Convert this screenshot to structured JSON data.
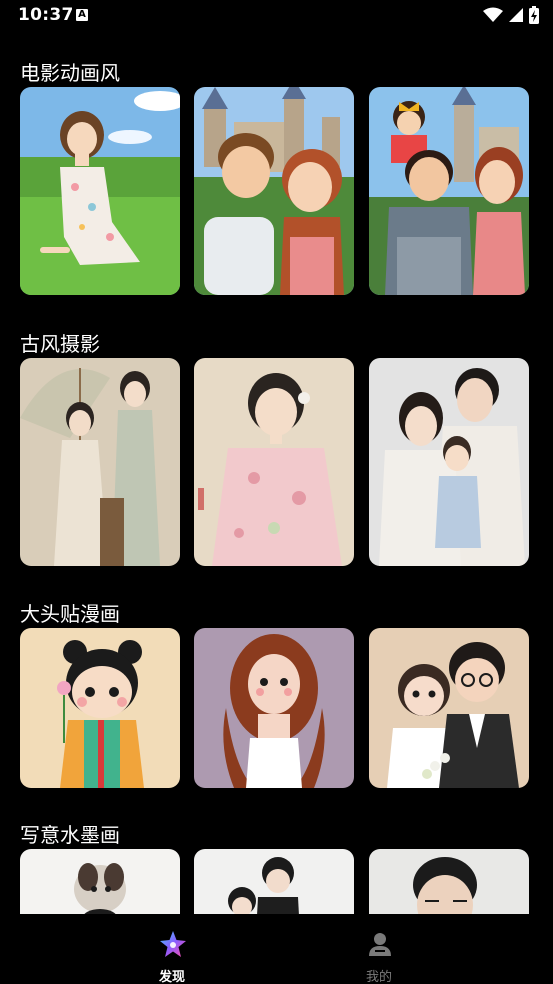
{
  "status_bar": {
    "time": "10:37",
    "notification": "A"
  },
  "sections": [
    {
      "title": "电影动画风"
    },
    {
      "title": "古风摄影"
    },
    {
      "title": "大头贴漫画"
    },
    {
      "title": "写意水墨画"
    }
  ],
  "bottom_nav": {
    "items": [
      {
        "label": "发现",
        "icon": "sparkle-star-icon",
        "active": true
      },
      {
        "label": "我的",
        "icon": "person-icon",
        "active": false
      }
    ]
  },
  "colors": {
    "background": "#000000",
    "active_label": "#ffffff",
    "inactive_label": "#7a7a7a"
  }
}
